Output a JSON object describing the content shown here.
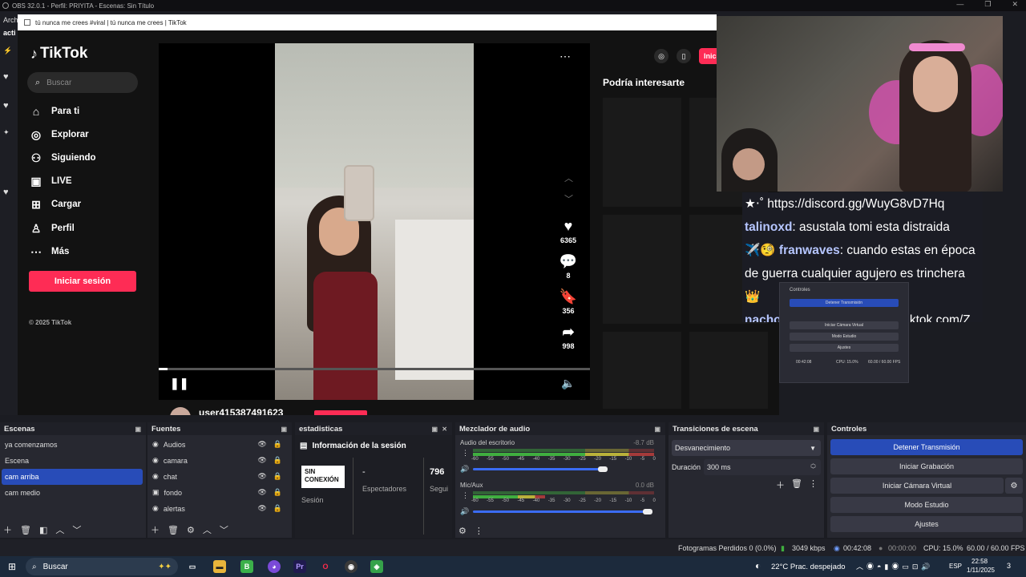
{
  "obs": {
    "title": "OBS 32.0.1 - Perfil: PRIYITA - Escenas: Sin Título",
    "menu_first": "Arch",
    "left_tab": "acti"
  },
  "browser": {
    "title": "tú nunca me crees #viral | tú nunca me crees | TikTok"
  },
  "tiktok": {
    "logo": "TikTok",
    "search_placeholder": "Buscar",
    "nav": [
      {
        "label": "Para ti",
        "icon": "home-icon"
      },
      {
        "label": "Explorar",
        "icon": "compass-icon"
      },
      {
        "label": "Siguiendo",
        "icon": "following-icon"
      },
      {
        "label": "LIVE",
        "icon": "live-icon"
      },
      {
        "label": "Cargar",
        "icon": "upload-icon"
      },
      {
        "label": "Perfil",
        "icon": "profile-icon"
      },
      {
        "label": "Más",
        "icon": "more-icon"
      }
    ],
    "login_button": "Iniciar sesión",
    "copyright": "© 2025 TikTok",
    "top_right_button": "Inic",
    "likes": "6365",
    "comments": "8",
    "saves": "356",
    "shares": "998",
    "username": "user415387491623",
    "suggested_title": "Podría interesarte",
    "progress": 0.02
  },
  "chat": {
    "lines": [
      {
        "user": "",
        "text": "★⋅˚ https://discord.gg/WuyG8vD7Hq"
      },
      {
        "user": "talinoxd",
        "text": ": asustala tomi esta distraida"
      },
      {
        "user": "✈️🧐 franwaves",
        "text": ": cuando estas en época"
      },
      {
        "user": "",
        "text": "de guerra cualquier agujero es trinchera"
      },
      {
        "user": "",
        "text": "👑"
      },
      {
        "user": "nachobenjamiin",
        "text": ": https://vm.tiktok.com/Z"
      }
    ]
  },
  "mini_preview": {
    "title": "Controles",
    "buttons": [
      "Detener Transmisión",
      "Iniciar Cámara Virtual",
      "Modo Estudio",
      "Ajustes"
    ],
    "time": "00:42:08",
    "cpu": "CPU: 15.0%",
    "fps": "60.00 / 60.00 FPS"
  },
  "docks": {
    "escenas": {
      "title": "Escenas",
      "items": [
        "ya comenzamos",
        "Escena",
        "cam arriba",
        "cam  medio"
      ],
      "selected": 2
    },
    "fuentes": {
      "title": "Fuentes",
      "items": [
        "Audios",
        "camara",
        "chat",
        "fondo",
        "alertas"
      ]
    },
    "estadisticas": {
      "title": "estadisticas",
      "info": "Información de la sesión",
      "badge_line1": "SIN",
      "badge_line2": "CONEXIÓN",
      "session": "Sesión",
      "dash": "-",
      "viewers": "Espectadores",
      "num": "796",
      "follow": "Segui"
    },
    "mezclador": {
      "title": "Mezclador de audio",
      "channels": [
        {
          "name": "Audio del escritorio",
          "db": "-8.7 dB",
          "level": 0.75
        },
        {
          "name": "Mic/Aux",
          "db": "0.0 dB",
          "level": 1.0
        }
      ],
      "scale": [
        "-60",
        "-55",
        "-50",
        "-45",
        "-40",
        "-35",
        "-30",
        "-25",
        "-20",
        "-15",
        "-10",
        "-5",
        "0"
      ]
    },
    "transiciones": {
      "title": "Transiciones de escena",
      "selected": "Desvanecimiento",
      "duration_label": "Duración",
      "duration_value": "300 ms"
    },
    "controles": {
      "title": "Controles",
      "buttons": [
        "Detener Transmisión",
        "Iniciar Grabación",
        "Iniciar Cámara Virtual",
        "Modo Estudio",
        "Ajustes"
      ]
    }
  },
  "status": {
    "frames": "Fotogramas Perdidos 0 (0.0%)",
    "bitrate": "3049 kbps",
    "live_time": "00:42:08",
    "rec_time": "00:00:00",
    "cpu": "CPU: 15.0%",
    "fps": "60.00 / 60.00 FPS"
  },
  "taskbar": {
    "search": "Buscar",
    "weather": "22°C  Prac. despejado",
    "lang": "ESP",
    "time": "22:58",
    "date": "1/11/2025",
    "notif": "3"
  },
  "colors": {
    "accent": "#284cb8",
    "tiktok_red": "#fe2c55",
    "dock_bg": "#272830"
  }
}
